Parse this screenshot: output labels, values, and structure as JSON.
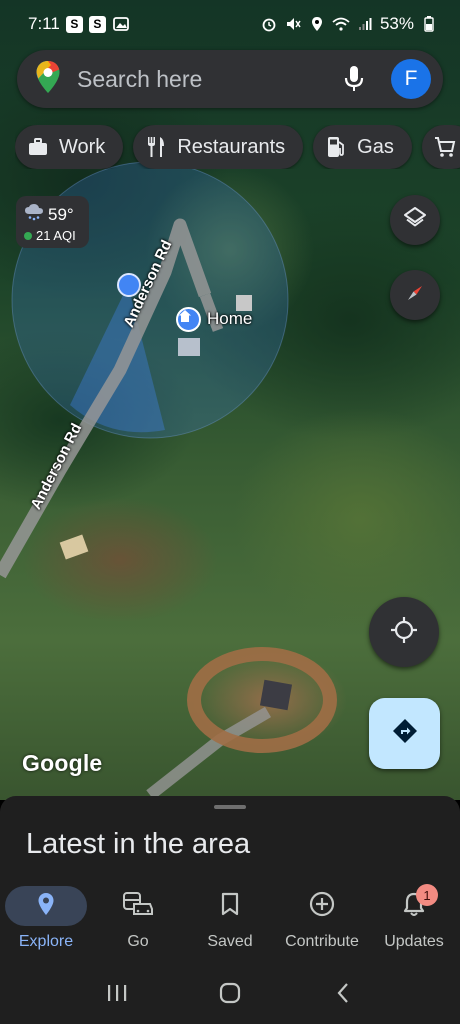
{
  "status_bar": {
    "time": "7:11",
    "notif_badges": [
      "S",
      "S"
    ],
    "battery": "53%"
  },
  "search": {
    "placeholder": "Search here",
    "avatar_letter": "F"
  },
  "chips": [
    {
      "label": "Work",
      "icon": "briefcase-icon"
    },
    {
      "label": "Restaurants",
      "icon": "fork-knife-icon"
    },
    {
      "label": "Gas",
      "icon": "gas-pump-icon"
    },
    {
      "label": "",
      "icon": "cart-icon"
    }
  ],
  "weather": {
    "temperature": "59°",
    "aqi": "21 AQI"
  },
  "map": {
    "road_label_upper": "Anderson Rd",
    "road_label_lower": "Anderson Rd",
    "home_label": "Home",
    "attribution": "Google"
  },
  "sheet": {
    "title": "Latest in the area"
  },
  "bottom_nav": [
    {
      "label": "Explore",
      "icon": "pin-icon",
      "active": true
    },
    {
      "label": "Go",
      "icon": "commute-icon",
      "active": false
    },
    {
      "label": "Saved",
      "icon": "bookmark-icon",
      "active": false
    },
    {
      "label": "Contribute",
      "icon": "add-circle-icon",
      "active": false
    },
    {
      "label": "Updates",
      "icon": "bell-icon",
      "active": false,
      "badge": "1"
    }
  ],
  "colors": {
    "accent": "#8ab4f8",
    "location_blue": "#4285f4",
    "directions_bg": "#c2e7ff",
    "badge": "#f28b82"
  }
}
